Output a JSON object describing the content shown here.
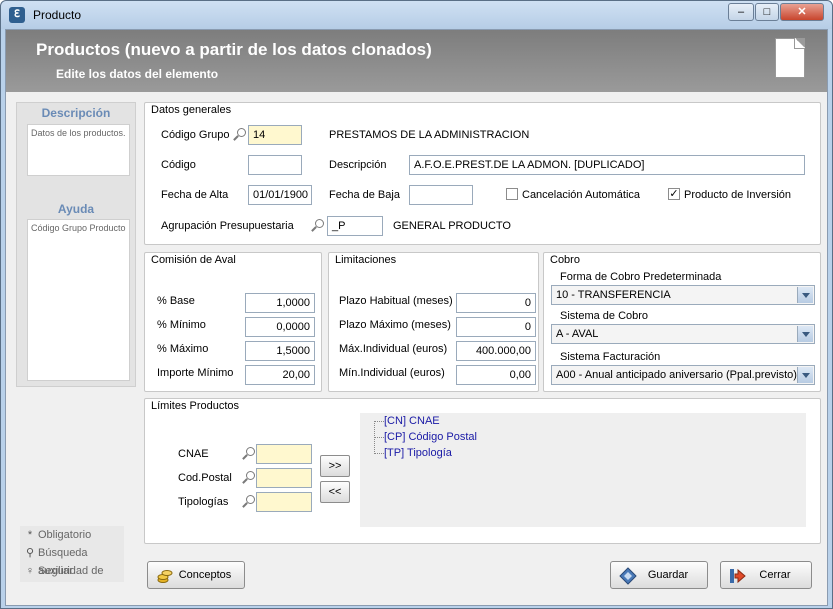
{
  "window": {
    "title": "Producto",
    "app_icon": "app-logo-icon",
    "minimize": "–",
    "maximize": "□",
    "close": "✕"
  },
  "header": {
    "title": "Productos (nuevo a partir de los datos clonados)",
    "subtitle": "Edite los datos del elemento"
  },
  "sidebar": {
    "descripcion_title": "Descripción",
    "descripcion_text": "Datos de los productos.",
    "ayuda_title": "Ayuda",
    "ayuda_text": "Código Grupo Producto"
  },
  "legend": {
    "obligatorio": "Obligatorio",
    "busqueda": "Búsqueda auxiliar",
    "seguridad": "Seguridad de"
  },
  "datos_generales": {
    "title": "Datos generales",
    "codigo_grupo_label": "Código Grupo",
    "codigo_grupo_value": "14",
    "codigo_grupo_desc": "PRESTAMOS DE LA ADMINISTRACION",
    "codigo_label": "Código",
    "codigo_value": "",
    "descripcion_label": "Descripción",
    "descripcion_value": "A.F.O.E.PREST.DE LA ADMON. [DUPLICADO]",
    "fecha_alta_label": "Fecha de Alta",
    "fecha_alta_value": "01/01/1900",
    "fecha_baja_label": "Fecha de Baja",
    "fecha_baja_value": "",
    "cancelacion_label": "Cancelación Automática",
    "cancelacion_checked": false,
    "inversion_label": "Producto de Inversión",
    "inversion_checked": true,
    "agrupacion_label": "Agrupación Presupuestaria",
    "agrupacion_value": "_P",
    "agrupacion_desc": "GENERAL PRODUCTO"
  },
  "comision": {
    "title": "Comisión de Aval",
    "rows": [
      {
        "label": "% Base",
        "value": "1,0000"
      },
      {
        "label": "% Mínimo",
        "value": "0,0000"
      },
      {
        "label": "% Máximo",
        "value": "1,5000"
      },
      {
        "label": "Importe Mínimo",
        "value": "20,00"
      }
    ]
  },
  "limitaciones": {
    "title": "Limitaciones",
    "rows": [
      {
        "label": "Plazo Habitual (meses)",
        "value": "0"
      },
      {
        "label": "Plazo Máximo (meses)",
        "value": "0"
      },
      {
        "label": "Máx.Individual (euros)",
        "value": "400.000,00"
      },
      {
        "label": "Mín.Individual (euros)",
        "value": "0,00"
      }
    ]
  },
  "cobro": {
    "title": "Cobro",
    "forma_label": "Forma de Cobro Predeterminada",
    "forma_value": "10 - TRANSFERENCIA",
    "sistema_label": "Sistema de Cobro",
    "sistema_value": "A - AVAL",
    "facturacion_label": "Sistema Facturación",
    "facturacion_value": "A00 - Anual anticipado aniversario (Ppal.previsto)"
  },
  "limites": {
    "title": "Límites Productos",
    "cnae_label": "CNAE",
    "postal_label": "Cod.Postal",
    "tipologias_label": "Tipologías",
    "add_label": ">>",
    "remove_label": "<<",
    "tree": [
      "[CN] CNAE",
      "[CP] Código Postal",
      "[TP] Tipología"
    ]
  },
  "footer": {
    "conceptos": "Conceptos",
    "guardar": "Guardar",
    "cerrar": "Cerrar"
  },
  "colors": {
    "accent": "#6a8bb6",
    "tree_link": "#1a1aa6",
    "field_required": "#fff8cf"
  }
}
